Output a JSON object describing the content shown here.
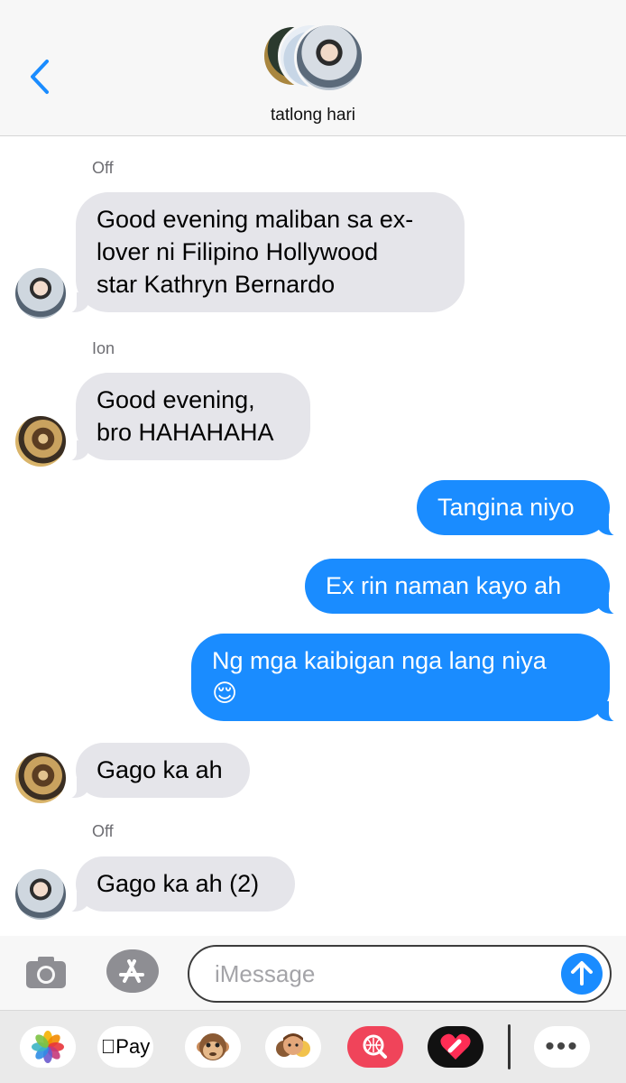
{
  "header": {
    "group_name": "tatlong hari"
  },
  "messages": [
    {
      "sender": "Off",
      "direction": "incoming",
      "avatar": "off",
      "text": "Good evening maliban sa ex-\nlover ni Filipino Hollywood\nstar Kathryn Bernardo"
    },
    {
      "sender": "Ion",
      "direction": "incoming",
      "avatar": "ion",
      "text": "Good evening,\nbro HAHAHAHA"
    },
    {
      "direction": "outgoing",
      "text": "Tangina niyo"
    },
    {
      "direction": "outgoing",
      "text": "Ex rin naman kayo ah"
    },
    {
      "direction": "outgoing",
      "text": "Ng mga kaibigan nga lang niya\n😌"
    },
    {
      "direction": "incoming",
      "avatar": "ion",
      "text": "Gago ka ah"
    },
    {
      "sender": "Off",
      "direction": "incoming",
      "avatar": "off",
      "text": "Gago ka ah (2)"
    }
  ],
  "input": {
    "placeholder": "iMessage"
  },
  "drawer": {
    "applepay_brand": "",
    "applepay_label": "Pay",
    "apps": [
      "photos-icon",
      "apple-pay-icon",
      "animoji-icon",
      "memoji-icon",
      "search-images-icon",
      "digital-touch-icon",
      "more-icon"
    ]
  },
  "colors": {
    "outgoing_bubble": "#1a8cff",
    "incoming_bubble": "#e5e5ea",
    "accent": "#1a8cff"
  }
}
